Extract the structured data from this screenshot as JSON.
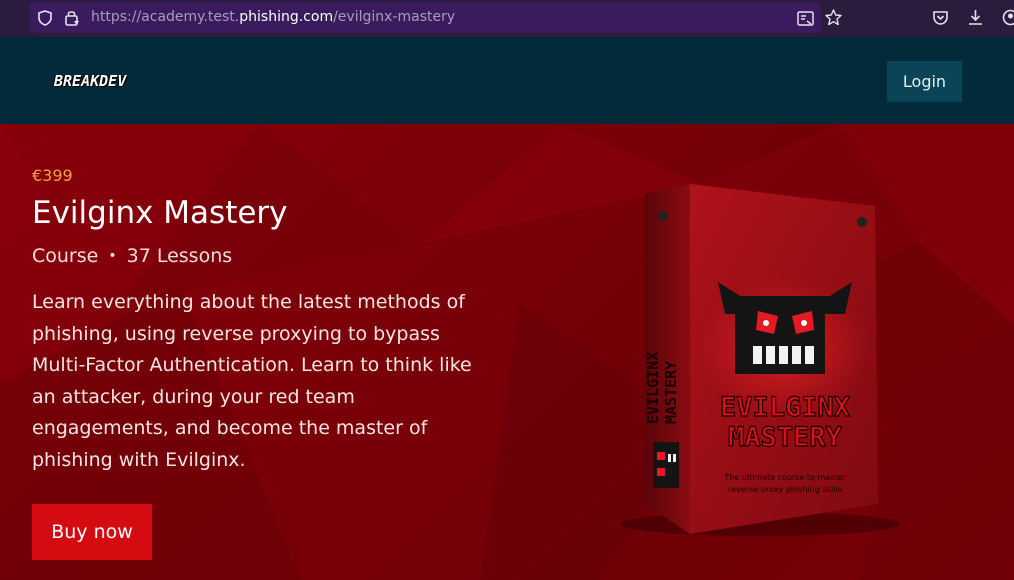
{
  "browser": {
    "url_prefix": "https://academy.test.",
    "url_domain": "phishing.com",
    "url_path": "/evilginx-mastery",
    "icons": [
      "shield-icon",
      "lock-icon",
      "reader-view-icon",
      "star-icon",
      "pocket-icon",
      "download-icon",
      "account-icon"
    ]
  },
  "header": {
    "logo_text": "BREAKDEV",
    "login_label": "Login"
  },
  "product": {
    "price": "€399",
    "title": "Evilginx Mastery",
    "type": "Course",
    "separator": "•",
    "lessons": "37 Lessons",
    "description": "Learn everything about the latest methods of phishing, using reverse proxying to bypass Multi-Factor Authentication. Learn to think like an attacker, during your red team engagements, and become the master of phishing with Evilginx.",
    "buy_label": "Buy now",
    "box_front_title_1": "EVILGINX",
    "box_front_title_2": "MASTERY",
    "box_side_title_1": "EVILGINX",
    "box_side_title_2": "MASTERY",
    "box_tagline_1": "The ultimate course to master",
    "box_tagline_2": "reverse-proxy phishing skills"
  },
  "colors": {
    "browser_bg": "#2b1b3d",
    "header_bg": "#032a3b",
    "hero_bg": "#7a0008",
    "price": "#f0a24a",
    "buy_button": "#d40b10",
    "login_button": "#0b4456"
  }
}
